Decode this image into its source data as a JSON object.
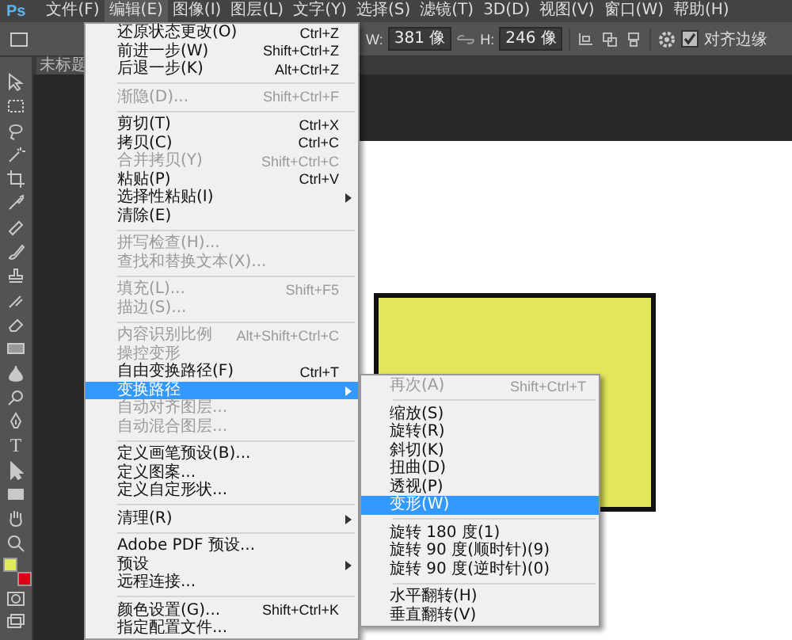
{
  "app_logo": "Ps",
  "menubar": [
    {
      "label": "文件(F)",
      "selected": false
    },
    {
      "label": "编辑(E)",
      "selected": true
    },
    {
      "label": "图像(I)",
      "selected": false
    },
    {
      "label": "图层(L)",
      "selected": false
    },
    {
      "label": "文字(Y)",
      "selected": false
    },
    {
      "label": "选择(S)",
      "selected": false
    },
    {
      "label": "滤镜(T)",
      "selected": false
    },
    {
      "label": "3D(D)",
      "selected": false
    },
    {
      "label": "视图(V)",
      "selected": false
    },
    {
      "label": "窗口(W)",
      "selected": false
    },
    {
      "label": "帮助(H)",
      "selected": false
    }
  ],
  "options_bar": {
    "width_label": "W:",
    "width": "381 像",
    "height_label": "H:",
    "height": "246 像",
    "align_edges": {
      "label": "对齐边缘",
      "checked": true
    }
  },
  "document_tab": "未标题",
  "type_tool_glyph": "T",
  "menu": {
    "items": [
      {
        "kind": "item",
        "label": "还原状态更改(O)",
        "shortcut": "Ctrl+Z",
        "disabled": false,
        "has_submenu": false,
        "selected": false
      },
      {
        "kind": "item",
        "label": "前进一步(W)",
        "shortcut": "Shift+Ctrl+Z",
        "disabled": false,
        "has_submenu": false,
        "selected": false
      },
      {
        "kind": "item",
        "label": "后退一步(K)",
        "shortcut": "Alt+Ctrl+Z",
        "disabled": false,
        "has_submenu": false,
        "selected": false
      },
      {
        "kind": "separator"
      },
      {
        "kind": "item",
        "label": "渐隐(D)...",
        "shortcut": "Shift+Ctrl+F",
        "disabled": true,
        "has_submenu": false,
        "selected": false
      },
      {
        "kind": "separator"
      },
      {
        "kind": "item",
        "label": "剪切(T)",
        "shortcut": "Ctrl+X",
        "disabled": false,
        "has_submenu": false,
        "selected": false
      },
      {
        "kind": "item",
        "label": "拷贝(C)",
        "shortcut": "Ctrl+C",
        "disabled": false,
        "has_submenu": false,
        "selected": false
      },
      {
        "kind": "item",
        "label": "合并拷贝(Y)",
        "shortcut": "Shift+Ctrl+C",
        "disabled": true,
        "has_submenu": false,
        "selected": false
      },
      {
        "kind": "item",
        "label": "粘贴(P)",
        "shortcut": "Ctrl+V",
        "disabled": false,
        "has_submenu": false,
        "selected": false
      },
      {
        "kind": "item",
        "label": "选择性粘贴(I)",
        "disabled": false,
        "has_submenu": true,
        "selected": false
      },
      {
        "kind": "item",
        "label": "清除(E)",
        "disabled": false,
        "has_submenu": false,
        "selected": false
      },
      {
        "kind": "separator"
      },
      {
        "kind": "item",
        "label": "拼写检查(H)...",
        "disabled": true,
        "has_submenu": false,
        "selected": false
      },
      {
        "kind": "item",
        "label": "查找和替换文本(X)...",
        "disabled": true,
        "has_submenu": false,
        "selected": false
      },
      {
        "kind": "separator"
      },
      {
        "kind": "item",
        "label": "填充(L)...",
        "shortcut": "Shift+F5",
        "disabled": true,
        "has_submenu": false,
        "selected": false
      },
      {
        "kind": "item",
        "label": "描边(S)...",
        "disabled": true,
        "has_submenu": false,
        "selected": false
      },
      {
        "kind": "separator"
      },
      {
        "kind": "item",
        "label": "内容识别比例",
        "shortcut": "Alt+Shift+Ctrl+C",
        "disabled": true,
        "has_submenu": false,
        "selected": false
      },
      {
        "kind": "item",
        "label": "操控变形",
        "disabled": true,
        "has_submenu": false,
        "selected": false
      },
      {
        "kind": "item",
        "label": "自由变换路径(F)",
        "shortcut": "Ctrl+T",
        "disabled": false,
        "has_submenu": false,
        "selected": false
      },
      {
        "kind": "item",
        "label": "变换路径",
        "disabled": false,
        "has_submenu": true,
        "selected": true
      },
      {
        "kind": "item",
        "label": "自动对齐图层...",
        "disabled": true,
        "has_submenu": false,
        "selected": false
      },
      {
        "kind": "item",
        "label": "自动混合图层...",
        "disabled": true,
        "has_submenu": false,
        "selected": false
      },
      {
        "kind": "separator"
      },
      {
        "kind": "item",
        "label": "定义画笔预设(B)...",
        "disabled": false,
        "has_submenu": false,
        "selected": false
      },
      {
        "kind": "item",
        "label": "定义图案...",
        "disabled": false,
        "has_submenu": false,
        "selected": false
      },
      {
        "kind": "item",
        "label": "定义自定形状...",
        "disabled": false,
        "has_submenu": false,
        "selected": false
      },
      {
        "kind": "separator"
      },
      {
        "kind": "item",
        "label": "清理(R)",
        "disabled": false,
        "has_submenu": true,
        "selected": false
      },
      {
        "kind": "separator"
      },
      {
        "kind": "item",
        "label": "Adobe PDF 预设...",
        "disabled": false,
        "has_submenu": false,
        "selected": false
      },
      {
        "kind": "item",
        "label": "预设",
        "disabled": false,
        "has_submenu": true,
        "selected": false
      },
      {
        "kind": "item",
        "label": "远程连接...",
        "disabled": false,
        "has_submenu": false,
        "selected": false
      },
      {
        "kind": "separator"
      },
      {
        "kind": "item",
        "label": "颜色设置(G)...",
        "shortcut": "Shift+Ctrl+K",
        "disabled": false,
        "has_submenu": false,
        "selected": false
      },
      {
        "kind": "item",
        "label": "指定配置文件...",
        "disabled": false,
        "has_submenu": false,
        "selected": false
      }
    ]
  },
  "submenu": {
    "items": [
      {
        "kind": "item",
        "label": "再次(A)",
        "shortcut": "Shift+Ctrl+T",
        "disabled": true,
        "selected": false
      },
      {
        "kind": "separator"
      },
      {
        "kind": "item",
        "label": "缩放(S)",
        "disabled": false,
        "selected": false
      },
      {
        "kind": "item",
        "label": "旋转(R)",
        "disabled": false,
        "selected": false
      },
      {
        "kind": "item",
        "label": "斜切(K)",
        "disabled": false,
        "selected": false
      },
      {
        "kind": "item",
        "label": "扭曲(D)",
        "disabled": false,
        "selected": false
      },
      {
        "kind": "item",
        "label": "透视(P)",
        "disabled": false,
        "selected": false
      },
      {
        "kind": "item",
        "label": "变形(W)",
        "disabled": false,
        "selected": true
      },
      {
        "kind": "separator"
      },
      {
        "kind": "item",
        "label": "旋转 180 度(1)",
        "disabled": false,
        "selected": false
      },
      {
        "kind": "item",
        "label": "旋转 90 度(顺时针)(9)",
        "disabled": false,
        "selected": false
      },
      {
        "kind": "item",
        "label": "旋转 90 度(逆时针)(0)",
        "disabled": false,
        "selected": false
      },
      {
        "kind": "separator"
      },
      {
        "kind": "item",
        "label": "水平翻转(H)",
        "disabled": false,
        "selected": false
      },
      {
        "kind": "item",
        "label": "垂直翻转(V)",
        "disabled": false,
        "selected": false
      }
    ]
  }
}
